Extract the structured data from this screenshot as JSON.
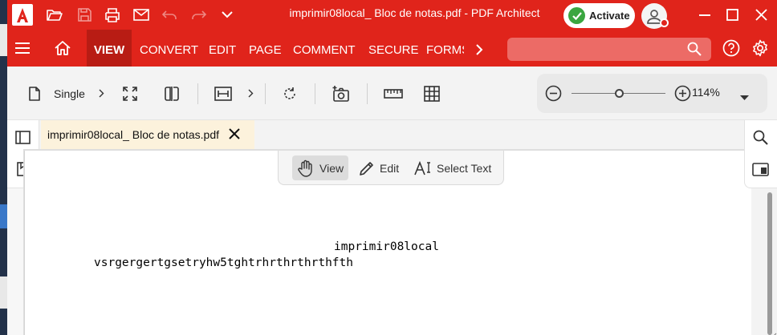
{
  "window": {
    "title": "imprimir08local_ Bloc de notas.pdf   -   PDF Architect",
    "activate_label": "Activate"
  },
  "ribbon": {
    "tabs": [
      "VIEW",
      "CONVERT",
      "EDIT",
      "PAGE",
      "COMMENT",
      "SECURE",
      "FORMS"
    ],
    "active_tab": "VIEW",
    "search_placeholder": ""
  },
  "toolbar": {
    "view_mode_label": "Single",
    "zoom_value": "114%",
    "zoom_level_fraction": 0.5
  },
  "document": {
    "tab_name": "imprimir08local_ Bloc de notas.pdf",
    "modes": [
      "View",
      "Edit",
      "Select Text"
    ],
    "active_mode": "View",
    "lines": [
      "imprimir08local",
      "vsrgergertgsetryhw5tghtrhrthrthrthfth"
    ]
  },
  "colors": {
    "brand_red": "#e0241b",
    "active_tab_red": "#b81c14",
    "activate_green": "#3aa640",
    "doc_tab_bg": "#fcf2dc"
  },
  "icons": {
    "titlebar": [
      "app-logo-icon",
      "open-folder-icon",
      "save-icon",
      "print-icon",
      "email-icon",
      "undo-icon",
      "redo-icon",
      "chevron-down-icon"
    ],
    "window_controls": [
      "minimize-icon",
      "maximize-icon",
      "close-icon"
    ],
    "toolbar": [
      "page-icon",
      "fullscreen-icon",
      "split-view-icon",
      "fit-width-icon",
      "rotate-icon",
      "snapshot-icon",
      "ruler-icon",
      "grid-icon"
    ]
  }
}
